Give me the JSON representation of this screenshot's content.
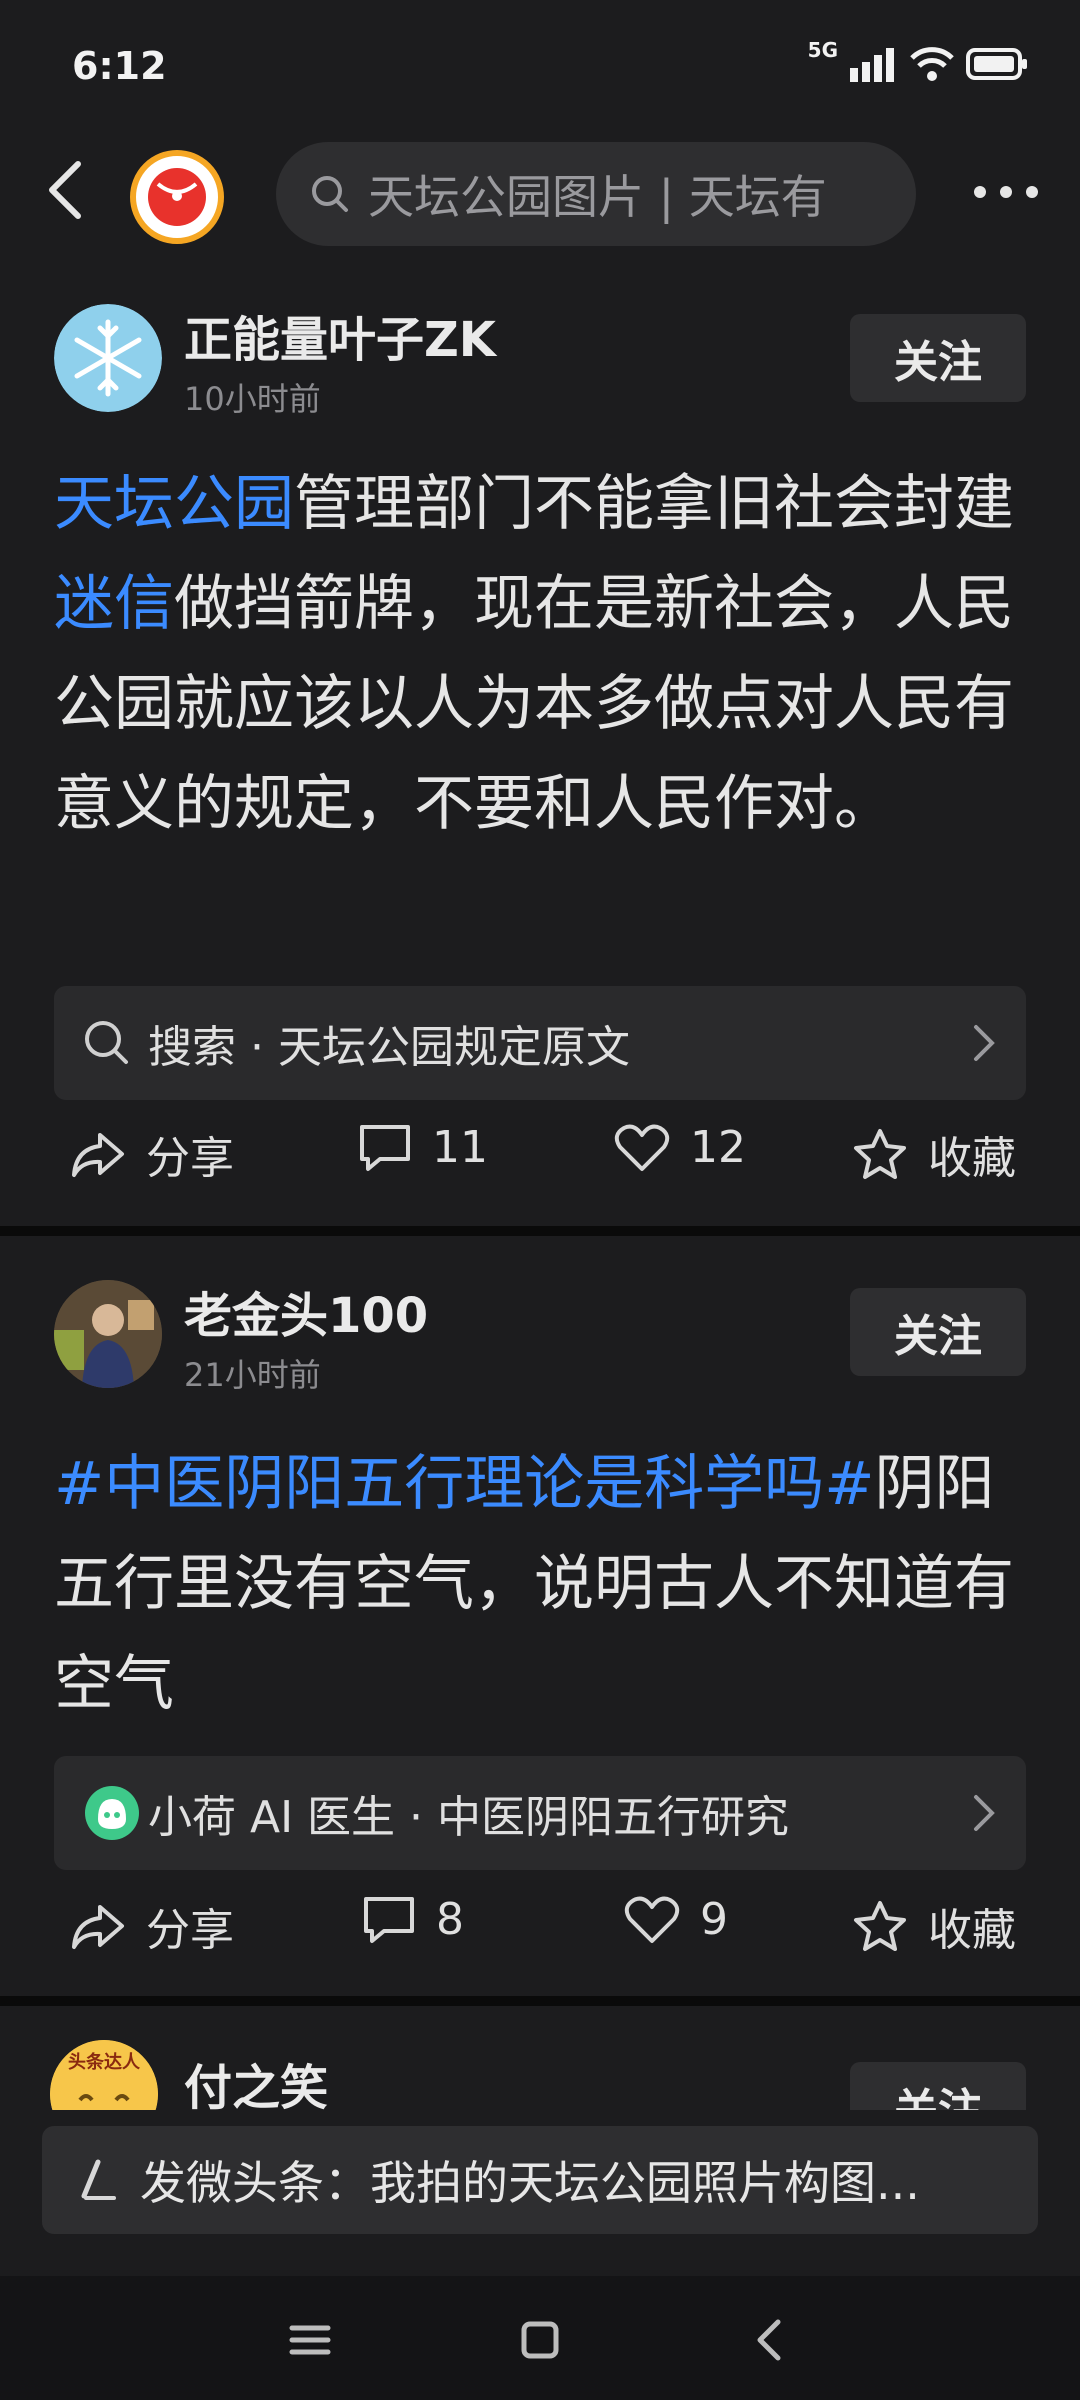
{
  "status": {
    "time": "6:12",
    "network": "5G"
  },
  "topbar": {
    "search_text": "天坛公园图片 | 天坛有"
  },
  "posts": [
    {
      "username": "正能量叶子ZK",
      "time": "10小时前",
      "follow_label": "关注",
      "text_parts": [
        {
          "t": "天坛公园",
          "hl": true
        },
        {
          "t": "管理部门不能拿旧社会封建",
          "hl": false
        },
        {
          "t": "迷信",
          "hl": true
        },
        {
          "t": "做挡箭牌，现在是新社会，人民公园就应该以人为本多做点对人民有意义的规定，不要和人民作对。",
          "hl": false
        }
      ],
      "search_card": "搜索 · 天坛公园规定原文",
      "actions": {
        "share": "分享",
        "comments": "11",
        "likes": "12",
        "favorite": "收藏"
      }
    },
    {
      "username": "老金头100",
      "time": "21小时前",
      "follow_label": "关注",
      "text_parts": [
        {
          "t": "#中医阴阳五行理论是科学吗#",
          "hl": true
        },
        {
          "t": "阴阳五行里没有空气，说明古人不知道有空气",
          "hl": false
        }
      ],
      "search_card": "小荷 AI 医生 · 中医阴阳五行研究",
      "actions": {
        "share": "分享",
        "comments": "8",
        "likes": "9",
        "favorite": "收藏"
      }
    },
    {
      "username": "付之笑",
      "follow_label": "关注",
      "avatar_badge": "头条达人"
    }
  ],
  "compose": {
    "text": "发微头条：我拍的天坛公园照片构图..."
  },
  "colors": {
    "accent": "#3b8bff",
    "background": "#1c1c1e"
  }
}
